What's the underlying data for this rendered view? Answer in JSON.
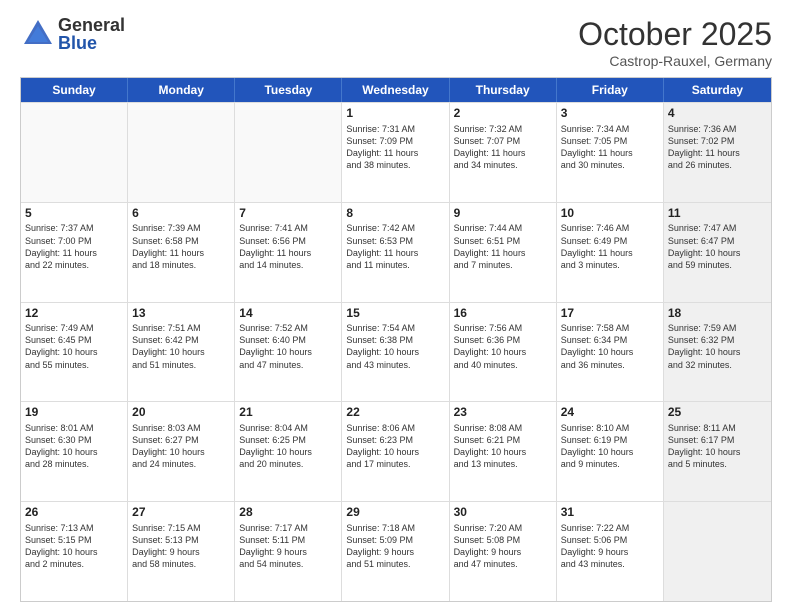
{
  "header": {
    "logo_general": "General",
    "logo_blue": "Blue",
    "title": "October 2025",
    "subtitle": "Castrop-Rauxel, Germany"
  },
  "days_of_week": [
    "Sunday",
    "Monday",
    "Tuesday",
    "Wednesday",
    "Thursday",
    "Friday",
    "Saturday"
  ],
  "weeks": [
    [
      {
        "day": "",
        "info": "",
        "shaded": false,
        "empty": true
      },
      {
        "day": "",
        "info": "",
        "shaded": false,
        "empty": true
      },
      {
        "day": "",
        "info": "",
        "shaded": false,
        "empty": true
      },
      {
        "day": "1",
        "info": "Sunrise: 7:31 AM\nSunset: 7:09 PM\nDaylight: 11 hours\nand 38 minutes.",
        "shaded": false,
        "empty": false
      },
      {
        "day": "2",
        "info": "Sunrise: 7:32 AM\nSunset: 7:07 PM\nDaylight: 11 hours\nand 34 minutes.",
        "shaded": false,
        "empty": false
      },
      {
        "day": "3",
        "info": "Sunrise: 7:34 AM\nSunset: 7:05 PM\nDaylight: 11 hours\nand 30 minutes.",
        "shaded": false,
        "empty": false
      },
      {
        "day": "4",
        "info": "Sunrise: 7:36 AM\nSunset: 7:02 PM\nDaylight: 11 hours\nand 26 minutes.",
        "shaded": true,
        "empty": false
      }
    ],
    [
      {
        "day": "5",
        "info": "Sunrise: 7:37 AM\nSunset: 7:00 PM\nDaylight: 11 hours\nand 22 minutes.",
        "shaded": false,
        "empty": false
      },
      {
        "day": "6",
        "info": "Sunrise: 7:39 AM\nSunset: 6:58 PM\nDaylight: 11 hours\nand 18 minutes.",
        "shaded": false,
        "empty": false
      },
      {
        "day": "7",
        "info": "Sunrise: 7:41 AM\nSunset: 6:56 PM\nDaylight: 11 hours\nand 14 minutes.",
        "shaded": false,
        "empty": false
      },
      {
        "day": "8",
        "info": "Sunrise: 7:42 AM\nSunset: 6:53 PM\nDaylight: 11 hours\nand 11 minutes.",
        "shaded": false,
        "empty": false
      },
      {
        "day": "9",
        "info": "Sunrise: 7:44 AM\nSunset: 6:51 PM\nDaylight: 11 hours\nand 7 minutes.",
        "shaded": false,
        "empty": false
      },
      {
        "day": "10",
        "info": "Sunrise: 7:46 AM\nSunset: 6:49 PM\nDaylight: 11 hours\nand 3 minutes.",
        "shaded": false,
        "empty": false
      },
      {
        "day": "11",
        "info": "Sunrise: 7:47 AM\nSunset: 6:47 PM\nDaylight: 10 hours\nand 59 minutes.",
        "shaded": true,
        "empty": false
      }
    ],
    [
      {
        "day": "12",
        "info": "Sunrise: 7:49 AM\nSunset: 6:45 PM\nDaylight: 10 hours\nand 55 minutes.",
        "shaded": false,
        "empty": false
      },
      {
        "day": "13",
        "info": "Sunrise: 7:51 AM\nSunset: 6:42 PM\nDaylight: 10 hours\nand 51 minutes.",
        "shaded": false,
        "empty": false
      },
      {
        "day": "14",
        "info": "Sunrise: 7:52 AM\nSunset: 6:40 PM\nDaylight: 10 hours\nand 47 minutes.",
        "shaded": false,
        "empty": false
      },
      {
        "day": "15",
        "info": "Sunrise: 7:54 AM\nSunset: 6:38 PM\nDaylight: 10 hours\nand 43 minutes.",
        "shaded": false,
        "empty": false
      },
      {
        "day": "16",
        "info": "Sunrise: 7:56 AM\nSunset: 6:36 PM\nDaylight: 10 hours\nand 40 minutes.",
        "shaded": false,
        "empty": false
      },
      {
        "day": "17",
        "info": "Sunrise: 7:58 AM\nSunset: 6:34 PM\nDaylight: 10 hours\nand 36 minutes.",
        "shaded": false,
        "empty": false
      },
      {
        "day": "18",
        "info": "Sunrise: 7:59 AM\nSunset: 6:32 PM\nDaylight: 10 hours\nand 32 minutes.",
        "shaded": true,
        "empty": false
      }
    ],
    [
      {
        "day": "19",
        "info": "Sunrise: 8:01 AM\nSunset: 6:30 PM\nDaylight: 10 hours\nand 28 minutes.",
        "shaded": false,
        "empty": false
      },
      {
        "day": "20",
        "info": "Sunrise: 8:03 AM\nSunset: 6:27 PM\nDaylight: 10 hours\nand 24 minutes.",
        "shaded": false,
        "empty": false
      },
      {
        "day": "21",
        "info": "Sunrise: 8:04 AM\nSunset: 6:25 PM\nDaylight: 10 hours\nand 20 minutes.",
        "shaded": false,
        "empty": false
      },
      {
        "day": "22",
        "info": "Sunrise: 8:06 AM\nSunset: 6:23 PM\nDaylight: 10 hours\nand 17 minutes.",
        "shaded": false,
        "empty": false
      },
      {
        "day": "23",
        "info": "Sunrise: 8:08 AM\nSunset: 6:21 PM\nDaylight: 10 hours\nand 13 minutes.",
        "shaded": false,
        "empty": false
      },
      {
        "day": "24",
        "info": "Sunrise: 8:10 AM\nSunset: 6:19 PM\nDaylight: 10 hours\nand 9 minutes.",
        "shaded": false,
        "empty": false
      },
      {
        "day": "25",
        "info": "Sunrise: 8:11 AM\nSunset: 6:17 PM\nDaylight: 10 hours\nand 5 minutes.",
        "shaded": true,
        "empty": false
      }
    ],
    [
      {
        "day": "26",
        "info": "Sunrise: 7:13 AM\nSunset: 5:15 PM\nDaylight: 10 hours\nand 2 minutes.",
        "shaded": false,
        "empty": false
      },
      {
        "day": "27",
        "info": "Sunrise: 7:15 AM\nSunset: 5:13 PM\nDaylight: 9 hours\nand 58 minutes.",
        "shaded": false,
        "empty": false
      },
      {
        "day": "28",
        "info": "Sunrise: 7:17 AM\nSunset: 5:11 PM\nDaylight: 9 hours\nand 54 minutes.",
        "shaded": false,
        "empty": false
      },
      {
        "day": "29",
        "info": "Sunrise: 7:18 AM\nSunset: 5:09 PM\nDaylight: 9 hours\nand 51 minutes.",
        "shaded": false,
        "empty": false
      },
      {
        "day": "30",
        "info": "Sunrise: 7:20 AM\nSunset: 5:08 PM\nDaylight: 9 hours\nand 47 minutes.",
        "shaded": false,
        "empty": false
      },
      {
        "day": "31",
        "info": "Sunrise: 7:22 AM\nSunset: 5:06 PM\nDaylight: 9 hours\nand 43 minutes.",
        "shaded": false,
        "empty": false
      },
      {
        "day": "",
        "info": "",
        "shaded": true,
        "empty": true
      }
    ]
  ]
}
